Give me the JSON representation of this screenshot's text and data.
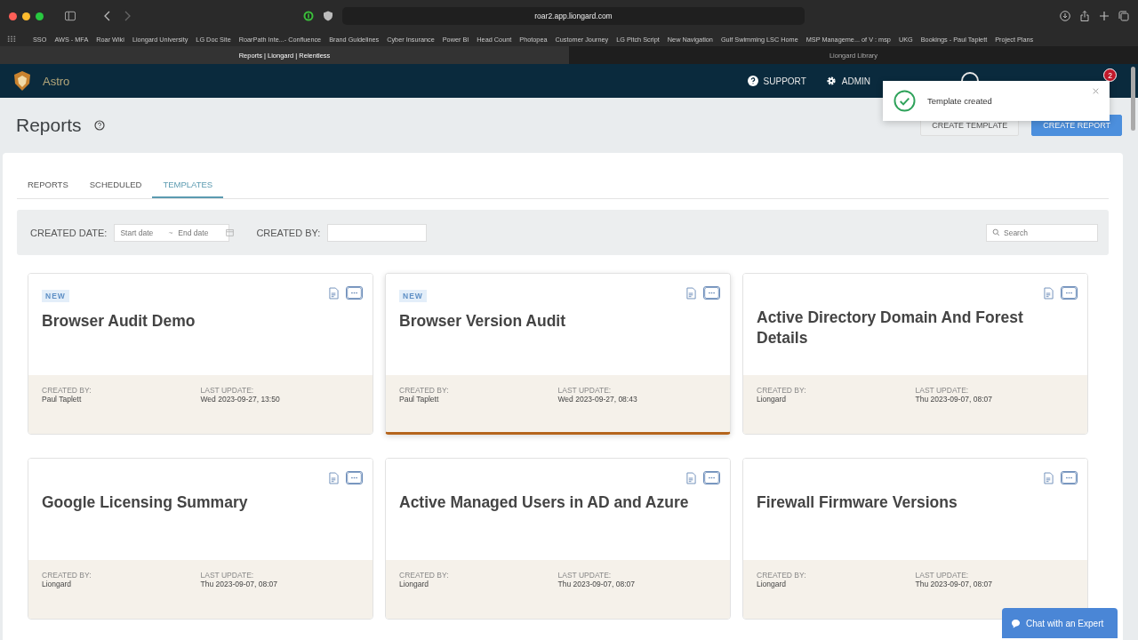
{
  "browser": {
    "url": "roar2.app.liongard.com",
    "bookmarks": [
      "SSO",
      "AWS - MFA",
      "Roar Wiki",
      "Liongard University",
      "LG Doc Site",
      "RoarPath Inte...- Confluence",
      "Brand Guidelines",
      "Cyber Insurance",
      "Power BI",
      "Head Count",
      "Photopea",
      "Customer Journey",
      "LG Pitch Script",
      "New Navigation",
      "Gulf Swimming LSC Home",
      "MSP Manageme... of V : msp",
      "UKG",
      "Bookings - Paul Taplett",
      "Project Plans"
    ],
    "tabs": [
      {
        "title": "Reports | Liongard | Relentless",
        "selected": true
      },
      {
        "title": "Liongard Library",
        "selected": false
      }
    ]
  },
  "app": {
    "name": "Astro",
    "nav": [
      {
        "label": "SUPPORT",
        "kind": "help"
      },
      {
        "label": "ADMIN",
        "kind": "gear"
      }
    ],
    "notifications": "2"
  },
  "toast": {
    "message": "Template created"
  },
  "page": {
    "title": "Reports",
    "buttons": [
      {
        "label": "CREATE TEMPLATE",
        "kind": "secondary"
      },
      {
        "label": "CREATE REPORT",
        "kind": "primary"
      }
    ]
  },
  "tabs": [
    {
      "label": "REPORTS",
      "selected": false
    },
    {
      "label": "SCHEDULED",
      "selected": false
    },
    {
      "label": "TEMPLATES",
      "selected": true
    }
  ],
  "filters": {
    "created_date_label": "CREATED DATE:",
    "start_placeholder": "Start date",
    "separator": "~",
    "end_placeholder": "End date",
    "created_by_label": "CREATED BY:",
    "search_placeholder": "Search"
  },
  "cards": [
    {
      "badge": "NEW",
      "title": "Browser Audit Demo",
      "created_by_label": "CREATED BY:",
      "created_by": "Paul Taplett",
      "updated_label": "LAST UPDATE:",
      "updated": "Wed 2023-09-27, 13:50",
      "highlighted": false
    },
    {
      "badge": "NEW",
      "title": "Browser Version Audit",
      "created_by_label": "CREATED BY:",
      "created_by": "Paul Taplett",
      "updated_label": "LAST UPDATE:",
      "updated": "Wed 2023-09-27, 08:43",
      "highlighted": true
    },
    {
      "title": "Active Directory Domain And Forest Details",
      "created_by_label": "CREATED BY:",
      "created_by": "Liongard",
      "updated_label": "LAST UPDATE:",
      "updated": "Thu 2023-09-07, 08:07",
      "highlighted": false
    },
    {
      "title": "Google Licensing Summary",
      "created_by_label": "CREATED BY:",
      "created_by": "Liongard",
      "updated_label": "LAST UPDATE:",
      "updated": "Thu 2023-09-07, 08:07",
      "highlighted": false
    },
    {
      "title": "Active Managed Users in AD and Azure",
      "created_by_label": "CREATED BY:",
      "created_by": "Liongard",
      "updated_label": "LAST UPDATE:",
      "updated": "Thu 2023-09-07, 08:07",
      "highlighted": false
    },
    {
      "title": "Firewall Firmware Versions",
      "created_by_label": "CREATED BY:",
      "created_by": "Liongard",
      "updated_label": "LAST UPDATE:",
      "updated": "Thu 2023-09-07, 08:07",
      "highlighted": false
    }
  ],
  "chat": {
    "label": "Chat with an Expert"
  }
}
